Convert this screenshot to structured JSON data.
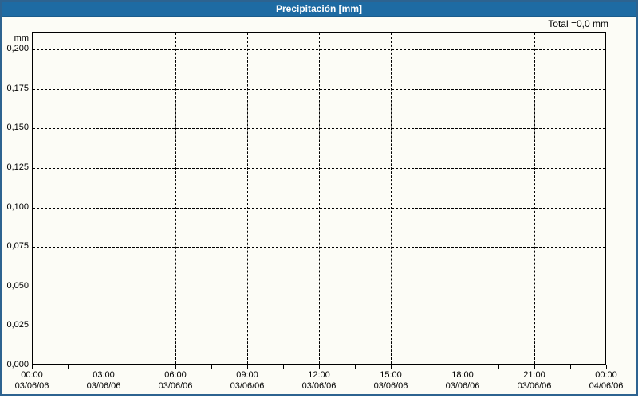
{
  "window": {
    "title": "Precipitación [mm]"
  },
  "colors": {
    "titlebar": "#1e6ba3",
    "frame": "#2d6390",
    "background": "#fcfcf6",
    "grid": "#000000",
    "title_text": "#ffffff"
  },
  "chart_data": {
    "type": "bar",
    "title": "Precipitación [mm]",
    "total_label": "Total =0,0 mm",
    "total_value_mm": 0.0,
    "ylabel": "mm",
    "unit": "mm",
    "grid": true,
    "values": [],
    "series": [],
    "ylim": [
      0,
      0.211
    ],
    "y_ticks": [
      "0,200",
      "0,175",
      "0,150",
      "0,125",
      "0,100",
      "0,075",
      "0,050",
      "0,025",
      "0,000"
    ],
    "x_ticks": [
      {
        "time": "00:00",
        "date": "03/06/06"
      },
      {
        "time": "03:00",
        "date": "03/06/06"
      },
      {
        "time": "06:00",
        "date": "03/06/06"
      },
      {
        "time": "09:00",
        "date": "03/06/06"
      },
      {
        "time": "12:00",
        "date": "03/06/06"
      },
      {
        "time": "15:00",
        "date": "03/06/06"
      },
      {
        "time": "18:00",
        "date": "03/06/06"
      },
      {
        "time": "21:00",
        "date": "03/06/06"
      },
      {
        "time": "00:00",
        "date": "04/06/06"
      }
    ],
    "x_minor_tick_hours": 1.5
  }
}
